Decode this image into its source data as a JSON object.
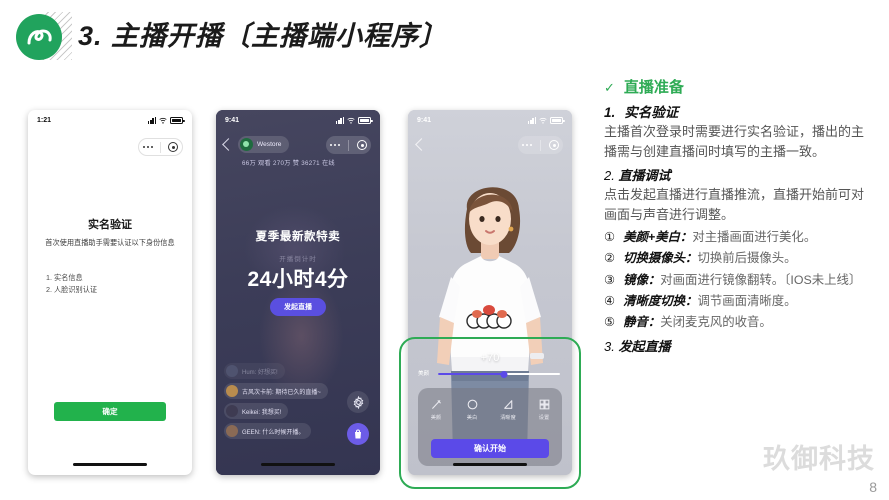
{
  "header": {
    "title": "3. 主播开播〔主播端小程序〕",
    "logo_icon": "wechat-miniprogram-logo"
  },
  "phone1": {
    "status_time": "1:21",
    "title": "实名验证",
    "subtitle": "首次使用直播助手需要认证以下身份信息",
    "list": [
      "1. 实名信息",
      "2. 人脸识别认证"
    ],
    "confirm_label": "确定",
    "accent": "#22b24c"
  },
  "phone2": {
    "status_time": "9:41",
    "shop_name": "Westore",
    "stats": "66万 观看 270万 赞 36271 在线",
    "promo_title": "夏季最新款特卖",
    "countdown_label": "开播倒计时",
    "countdown_value": "24小时4分",
    "golive_label": "发起直播",
    "chat": [
      {
        "user": "Hum",
        "text": "好想买!"
      },
      {
        "user": "古风次卡前",
        "text": "期待已久的直播~"
      },
      {
        "user": "Keikei",
        "text": "我想买!"
      },
      {
        "user": "GEEN",
        "text": "什么时候开播。"
      }
    ],
    "gear_icon": "gear-icon",
    "bag_icon": "shopping-bag-icon",
    "accent": "#5a4fe0"
  },
  "phone3": {
    "status_time": "9:41",
    "slider_label": "美颜",
    "slider_value": "+70",
    "tools": [
      {
        "label": "美颜",
        "icon": "beauty-wand-icon"
      },
      {
        "label": "美白",
        "icon": "whiten-circle-icon"
      },
      {
        "label": "清晰度",
        "icon": "clarity-triangle-icon"
      },
      {
        "label": "设置",
        "icon": "settings-grid-icon"
      }
    ],
    "confirm_label": "确认开始",
    "accent": "#5b4ae8",
    "highlight_color": "#2eab55"
  },
  "right": {
    "section_check": "✓",
    "section_title": "直播准备",
    "item1_num": "1.",
    "item1_title": "实名验证",
    "item1_body": "主播首次登录时需要进行实名验证，播出的主播需与创建直播间时填写的主播一致。",
    "item2_num": "2.",
    "item2_title": "直播调试",
    "item2_body": "点击发起直播进行直播推流，直播开始前可对画面与声音进行调整。",
    "sub_items": [
      {
        "marker": "①",
        "title": "美颜+美白：",
        "body": "对主播画面进行美化。"
      },
      {
        "marker": "②",
        "title": "切换摄像头：",
        "body": "切换前后摄像头。"
      },
      {
        "marker": "③",
        "title": "镜像：",
        "body": "对画面进行镜像翻转。〔IOS未上线〕"
      },
      {
        "marker": "④",
        "title": "清晰度切换：",
        "body": "调节画面清晰度。"
      },
      {
        "marker": "⑤",
        "title": "静音：",
        "body": "关闭麦克风的收音。"
      }
    ],
    "item3_num": "3.",
    "item3_title": "发起直播",
    "accent": "#2eab55"
  },
  "footer": {
    "watermark": "玖御科技",
    "page_number": "8"
  }
}
